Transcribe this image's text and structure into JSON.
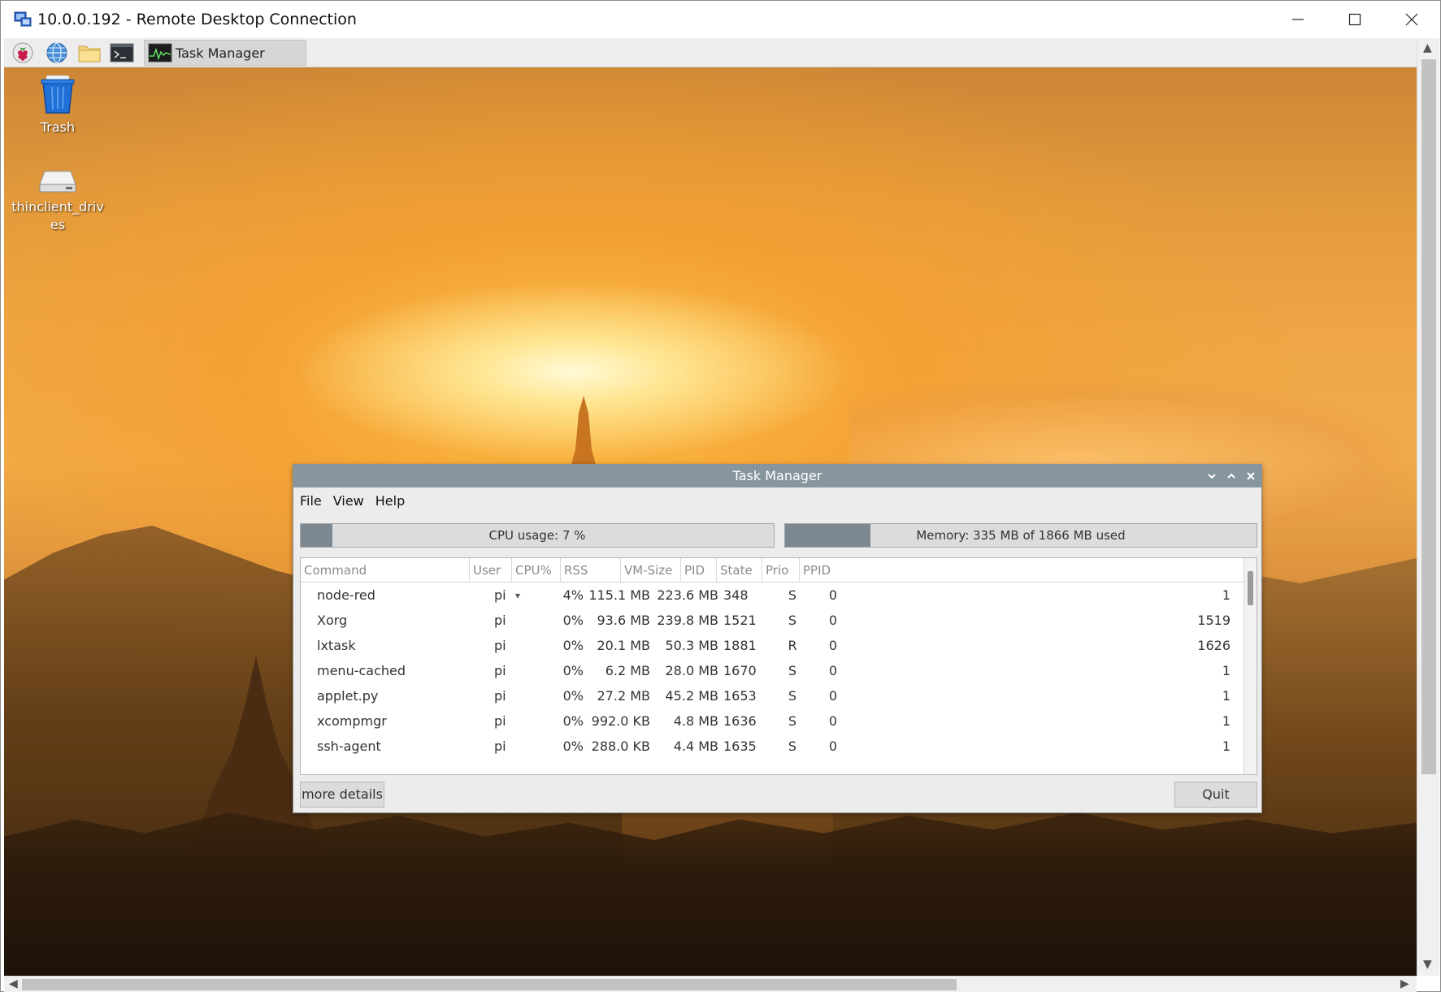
{
  "rdp": {
    "title": "10.0.0.192 - Remote Desktop Connection"
  },
  "panel": {
    "launchers": [
      "raspberry-menu-icon",
      "web-browser-icon",
      "file-manager-icon",
      "terminal-icon"
    ],
    "task_button_label": "Task Manager"
  },
  "desktop": {
    "icons": [
      {
        "label": "Trash",
        "icon": "trash-icon"
      },
      {
        "label": "thinclient_drives",
        "icon": "drive-icon"
      }
    ]
  },
  "taskmgr": {
    "title": "Task Manager",
    "menu": [
      "File",
      "View",
      "Help"
    ],
    "cpu": {
      "label": "CPU usage: 7 %",
      "fraction": 0.07
    },
    "memory": {
      "label": "Memory: 335 MB of 1866 MB used",
      "fraction": 0.18
    },
    "columns": [
      "Command",
      "User",
      "CPU%",
      "RSS",
      "VM-Size",
      "PID",
      "State",
      "Prio",
      "PPID"
    ],
    "sort_indicator": "▾",
    "rows": [
      {
        "command": "node-red",
        "user": "pi",
        "cpu": "4%",
        "rss": "115.1 MB",
        "vm": "223.6 MB",
        "pid": "348",
        "state": "S",
        "prio": "0",
        "ppid": "1"
      },
      {
        "command": "Xorg",
        "user": "pi",
        "cpu": "0%",
        "rss": "93.6 MB",
        "vm": "239.8 MB",
        "pid": "1521",
        "state": "S",
        "prio": "0",
        "ppid": "1519"
      },
      {
        "command": "lxtask",
        "user": "pi",
        "cpu": "0%",
        "rss": "20.1 MB",
        "vm": "50.3 MB",
        "pid": "1881",
        "state": "R",
        "prio": "0",
        "ppid": "1626"
      },
      {
        "command": "menu-cached",
        "user": "pi",
        "cpu": "0%",
        "rss": "6.2 MB",
        "vm": "28.0 MB",
        "pid": "1670",
        "state": "S",
        "prio": "0",
        "ppid": "1"
      },
      {
        "command": "applet.py",
        "user": "pi",
        "cpu": "0%",
        "rss": "27.2 MB",
        "vm": "45.2 MB",
        "pid": "1653",
        "state": "S",
        "prio": "0",
        "ppid": "1"
      },
      {
        "command": "xcompmgr",
        "user": "pi",
        "cpu": "0%",
        "rss": "992.0 KB",
        "vm": "4.8 MB",
        "pid": "1636",
        "state": "S",
        "prio": "0",
        "ppid": "1"
      },
      {
        "command": "ssh-agent",
        "user": "pi",
        "cpu": "0%",
        "rss": "288.0 KB",
        "vm": "4.4 MB",
        "pid": "1635",
        "state": "S",
        "prio": "0",
        "ppid": "1"
      }
    ],
    "buttons": {
      "details": "more details",
      "quit": "Quit"
    }
  },
  "colors": {
    "tm_titlebar": "#87959f",
    "meter_fill": "#7b8791",
    "panel_bg": "#ededed"
  }
}
